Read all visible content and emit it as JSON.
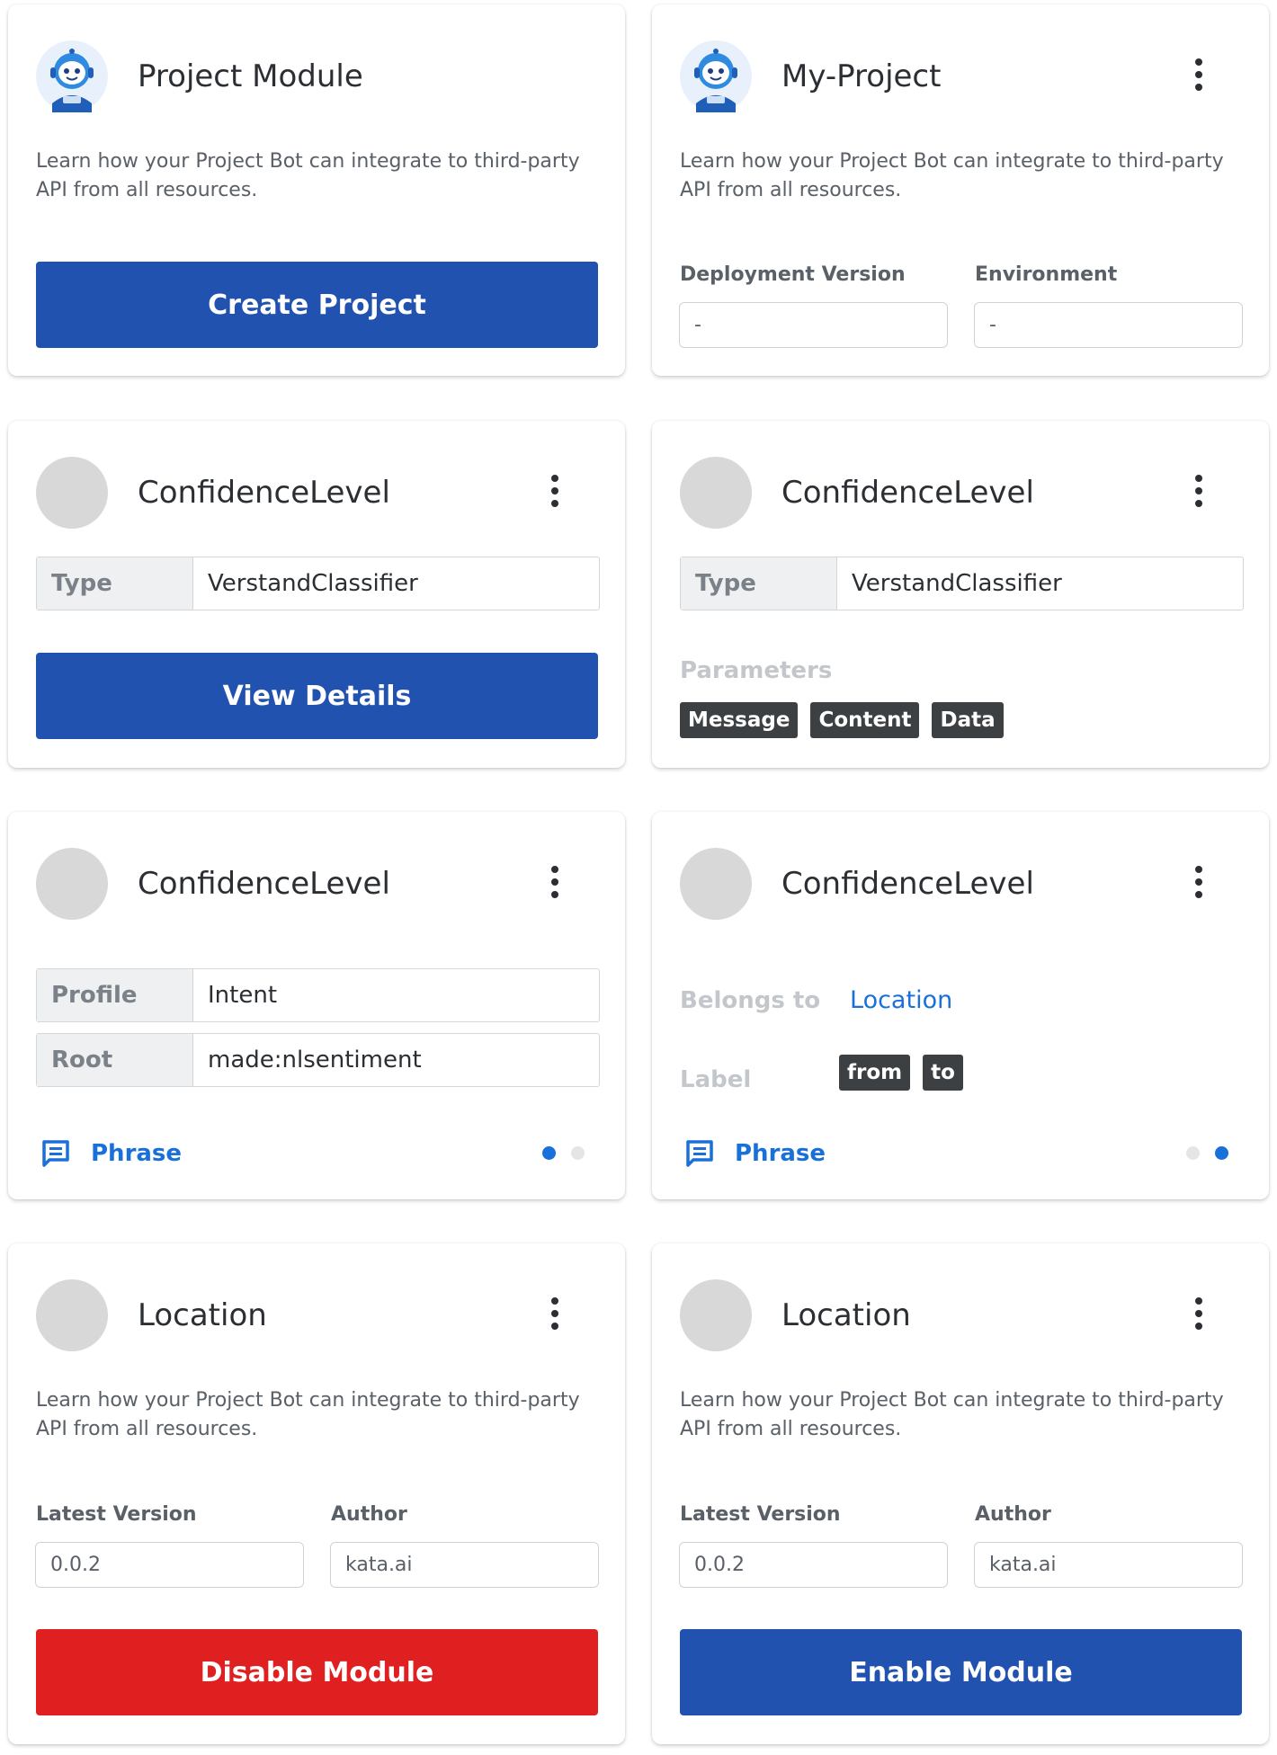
{
  "common": {
    "description": "Learn how your Project Bot can integrate to third-party API from all resources."
  },
  "card1": {
    "title": "Project Module",
    "button": "Create Project"
  },
  "card2": {
    "title": "My-Project",
    "deployment_label": "Deployment Version",
    "deployment_value": "-",
    "environment_label": "Environment",
    "environment_value": "-"
  },
  "card3": {
    "title": "ConfidenceLevel",
    "type_key": "Type",
    "type_value": "VerstandClassifier",
    "button": "View Details"
  },
  "card4": {
    "title": "ConfidenceLevel",
    "type_key": "Type",
    "type_value": "VerstandClassifier",
    "parameters_label": "Parameters",
    "parameters": [
      "Message",
      "Content",
      "Data"
    ]
  },
  "card5": {
    "title": "ConfidenceLevel",
    "profile_key": "Profile",
    "profile_value": "Intent",
    "root_key": "Root",
    "root_value": "made:nlsentiment",
    "phrase_label": "Phrase",
    "active_dot": 1,
    "dot_count": 2
  },
  "card6": {
    "title": "ConfidenceLevel",
    "belongs_label": "Belongs to",
    "belongs_value": "Location",
    "label_label": "Label",
    "labels": [
      "from",
      "to"
    ],
    "phrase_label": "Phrase",
    "active_dot": 2,
    "dot_count": 2
  },
  "card7": {
    "title": "Location",
    "version_label": "Latest Version",
    "version_value": "0.0.2",
    "author_label": "Author",
    "author_value": "kata.ai",
    "button": "Disable Module"
  },
  "card8": {
    "title": "Location",
    "version_label": "Latest Version",
    "version_value": "0.0.2",
    "author_label": "Author",
    "author_value": "kata.ai",
    "button": "Enable Module"
  },
  "icons": [
    "robot-avatar-icon",
    "more-vertical-icon",
    "chat-message-icon"
  ],
  "colors": {
    "primary": "#2152b0",
    "danger": "#e02020",
    "link": "#1a70d9",
    "chip": "#3c4043"
  }
}
